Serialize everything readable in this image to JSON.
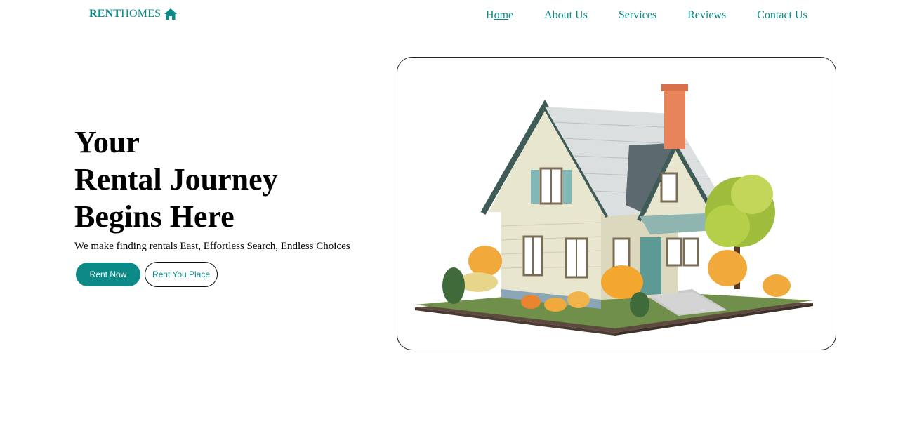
{
  "brand": {
    "bold": "RENT",
    "rest": "HOMES",
    "icon": "home-icon",
    "color": "#0b8a87"
  },
  "nav": {
    "items": [
      {
        "label": "About Us"
      },
      {
        "label": "Services"
      },
      {
        "label": "Reviews"
      },
      {
        "label": "Contact Us"
      }
    ],
    "home": {
      "pre": "H",
      "underlined": "om",
      "post": "e"
    }
  },
  "hero": {
    "title_lines": [
      "Your",
      "Rental Journey",
      "Begins Here"
    ],
    "subtitle": "We make finding rentals East, Effortless Search, Endless Choices",
    "primary_button": "Rent Now",
    "secondary_button": "Rent You Place",
    "image_icon": "house-illustration"
  },
  "colors": {
    "accent": "#0b8a87"
  }
}
